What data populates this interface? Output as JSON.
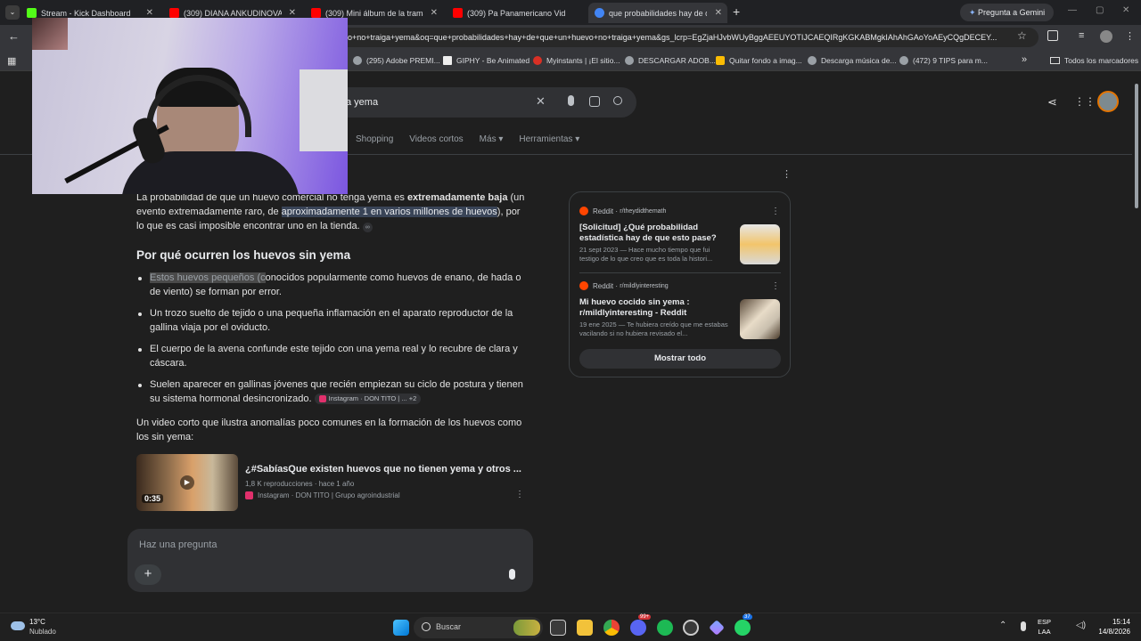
{
  "tabs": [
    {
      "title": "Stream - Kick Dashboard",
      "color": "#53fc18"
    },
    {
      "title": "(309) DIANA ANKUDINOVA (Д",
      "color": "#ff0000"
    },
    {
      "title": "(309) Mini álbum de la trama d",
      "color": "#ff0000"
    },
    {
      "title": "(309) Pa Panamericano Video C",
      "color": "#ff0000"
    },
    {
      "title": "que probabilidades hay de que",
      "color": "#4285f4"
    }
  ],
  "gemini_button": "Pregunta a Gemini",
  "url": "o+no+traiga+yema&oq=que+probabilidades+hay+de+que+un+huevo+no+traiga+yema&gs_lcrp=EgZjaHJvbWUyBggAEEUYOTIJCAEQIRgKGKABMgkIAhAhGAoYoAEyCQgDECEY...",
  "bookmarks": [
    "(295) Adobe PREMI...",
    "GIPHY - Be Animated",
    "Myinstants | ¡El sitio...",
    "DESCARGAR ADOB...",
    "Quitar fondo a imag...",
    "Descarga música de...",
    "(472) 9 TIPS para m..."
  ],
  "all_bookmarks": "Todos los marcadores",
  "search": {
    "query": "a yema"
  },
  "filters": [
    "Shopping",
    "Videos cortos",
    "Más",
    "Herramientas"
  ],
  "intro": {
    "p1": "La probabilidad de que un huevo comercial no tenga yema es ",
    "bold": "extremadamente baja",
    "p2": " (un evento extremadamente raro, de ",
    "hl": "aproximadamente 1 en varios millones de huevos",
    "p3": "), por lo que es casi imposible encontrar uno en la tienda."
  },
  "heading": "Por qué ocurren los huevos sin yema",
  "bullets": {
    "b1_hl": "Estos huevos pequeños (c",
    "b1_rest": "onocidos popularmente como huevos de enano, de hada o de viento) se forman por error.",
    "b2": "Un trozo suelto de tejido o una pequeña inflamación en el aparato reproductor de la gallina viaja por el oviducto.",
    "b3": "El cuerpo de la avena confunde este tejido con una yema real y lo recubre de clara y cáscara.",
    "b4": "Suelen aparecer en gallinas jóvenes que recién empiezan su ciclo de postura y tienen su sistema hormonal desincronizado.",
    "b4_chip": "Instagram · DON TITO | ...",
    "b4_more": "+2"
  },
  "video_intro": "Un video corto que ilustra anomalías poco comunes en la formación de los huevos como los sin yema:",
  "video": {
    "title": "¿#SabíasQue existen huevos que no tienen yema y otros ...",
    "meta": "1,8 K reproducciones · hace 1 año",
    "source": "Instagram · DON TITO | Grupo agroindustrial",
    "duration": "0:35"
  },
  "results": [
    {
      "site": "Reddit",
      "sub": "r/theydidthemath",
      "title": "[Solicitud] ¿Qué probabilidad estadística hay de que esto pase?",
      "snippet": "21 sept 2023 — Hace mucho tiempo que fui testigo de lo que creo que es toda la histori..."
    },
    {
      "site": "Reddit",
      "sub": "r/mildlyinteresting",
      "title": "Mi huevo cocido sin yema : r/mildlyinteresting - Reddit",
      "snippet": "19 ene 2025 — Te hubiera creído que me estabas vacilando si no hubiera revisado el..."
    }
  ],
  "show_all": "Mostrar todo",
  "ask_placeholder": "Haz una pregunta",
  "taskbar": {
    "temp": "13°C",
    "weather": "Nublado",
    "search": "Buscar",
    "lang1": "ESP",
    "lang2": "LAA",
    "time": "15:14",
    "date": "14/8/2026",
    "badge1": "99+",
    "badge2": "37"
  }
}
